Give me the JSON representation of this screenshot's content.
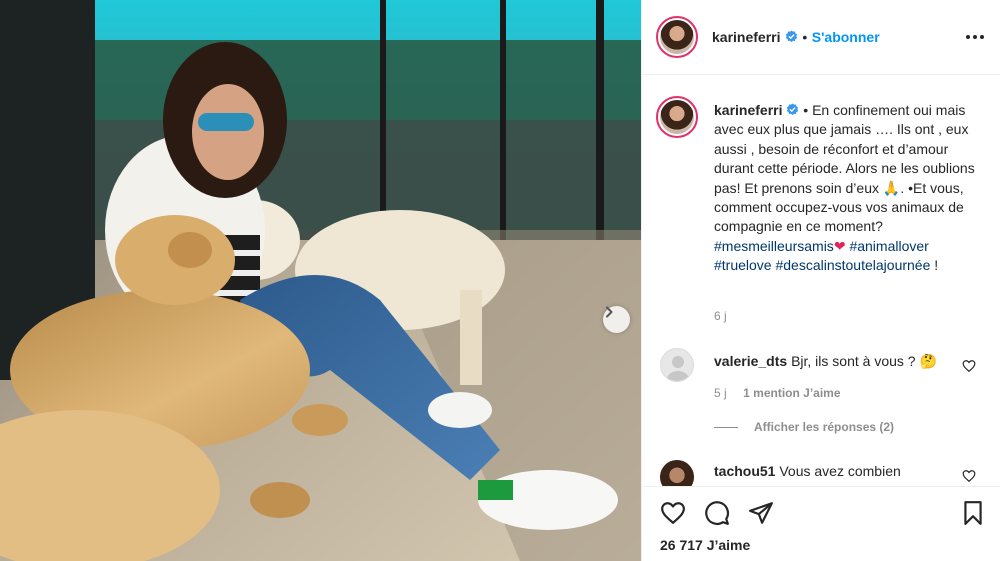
{
  "post": {
    "username": "karineferri",
    "follow_label": "S'abonner",
    "caption_prefix": "•",
    "caption_text": "En confinement oui mais avec eux plus que jamais …. Ils ont , eux aussi , besoin de réconfort et d’amour durant cette période. Alors ne les oublions pas! Et prenons soin d’eux",
    "caption_text_2": ". •Et vous, comment occupez-vous vos animaux de compagnie en ce moment?",
    "hashtags": [
      "#mesmeilleursamis",
      "#animallover",
      "#truelove",
      "#descalinstoutelajournée"
    ],
    "caption_end": "!",
    "caption_time": "6 j",
    "likes": "26 717 J’aime"
  },
  "comments": [
    {
      "username": "valerie_dts",
      "text": "Bjr, ils sont à vous ?",
      "time": "5 j",
      "likes": "1 mention J’aime",
      "replies": "Afficher les réponses (2)"
    },
    {
      "username": "tachou51",
      "text": "Vous avez combien"
    }
  ],
  "icons": {
    "verified": "verified-badge-icon",
    "more": "more-options-icon",
    "like": "heart-icon",
    "comment": "comment-icon",
    "share": "paper-plane-icon",
    "save": "bookmark-icon",
    "next": "chevron-right-icon",
    "pray": "praying-hands-emoji",
    "red_heart": "red-heart-emoji",
    "thinking": "thinking-face-emoji"
  },
  "colors": {
    "link_blue": "#0095f6",
    "hashtag": "#00376b",
    "muted": "#8e8e8e",
    "story_ring": "#e1306c"
  }
}
